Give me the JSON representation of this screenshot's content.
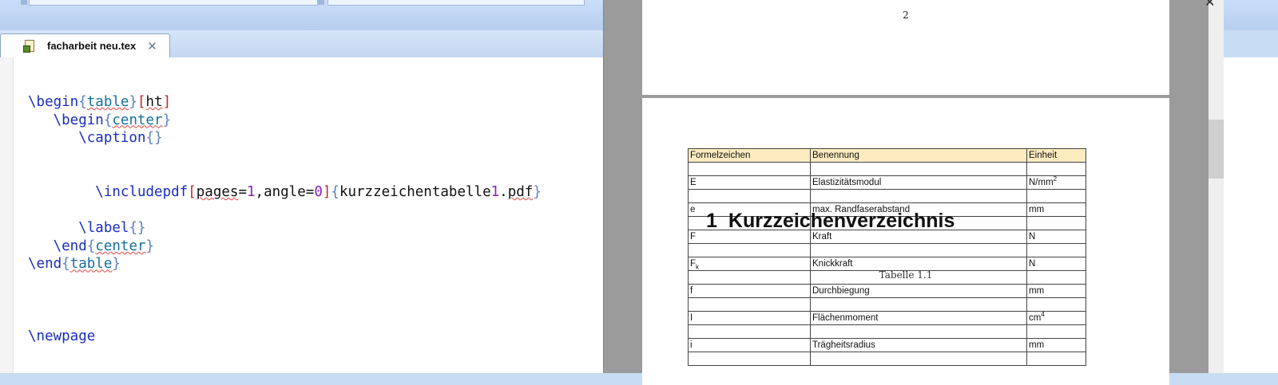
{
  "tab": {
    "label": "facharbeit neu.tex",
    "close": "✕"
  },
  "code_lines": [
    {
      "indent": "",
      "cmd": "\\begin",
      "arg": "table",
      "opt": "ht"
    },
    {
      "indent": "   ",
      "cmd": "\\begin",
      "arg": "center"
    },
    {
      "indent": "      ",
      "cmd": "\\caption",
      "arg": ""
    },
    {
      "blank": true
    },
    {
      "blank": true
    },
    {
      "indent": "        ",
      "cmd": "\\includepdf",
      "special": "includepdf"
    },
    {
      "blank": true
    },
    {
      "indent": "      ",
      "cmd": "\\label",
      "arg": ""
    },
    {
      "indent": "   ",
      "cmd": "\\end",
      "arg": "center"
    },
    {
      "indent": "",
      "cmd": "\\end",
      "arg": "table"
    },
    {
      "blank": true
    },
    {
      "blank": true
    },
    {
      "blank": true
    },
    {
      "indent": "",
      "cmd": "\\newpage"
    }
  ],
  "includepdf": {
    "opt_key1": "pages",
    "opt_val1": "1",
    "opt_key2": "angle",
    "opt_val2": "0",
    "file_a": "kurzzeichentabelle",
    "file_num": "1",
    "file_b": ".pdf"
  },
  "viewer": {
    "close": "✕",
    "page_number": "2",
    "heading_number": "1",
    "heading_text": "Kurzzeichenverzeichnis",
    "caption": "Tabelle 1.1",
    "table": {
      "headers": [
        "Formelzeichen",
        "Benennung",
        "Einheit"
      ],
      "rows": [
        [
          "",
          "",
          ""
        ],
        [
          "E",
          "Elastizitätsmodul",
          "N/mm",
          "2"
        ],
        [
          "",
          "",
          ""
        ],
        [
          "e",
          "max. Randfaserabstand",
          "mm"
        ],
        [
          "",
          "",
          ""
        ],
        [
          "F",
          "Kraft",
          "N"
        ],
        [
          "",
          "",
          ""
        ],
        [
          "F",
          "Knickkraft",
          "N",
          "",
          "k"
        ],
        [
          "",
          "",
          ""
        ],
        [
          "f",
          "Durchbiegung",
          "mm"
        ],
        [
          "",
          "",
          ""
        ],
        [
          "I",
          "Flächenmoment",
          "cm",
          "4"
        ],
        [
          "",
          "",
          ""
        ],
        [
          "i",
          "Trägheitsradius",
          "mm"
        ],
        [
          "",
          "",
          ""
        ]
      ]
    }
  }
}
